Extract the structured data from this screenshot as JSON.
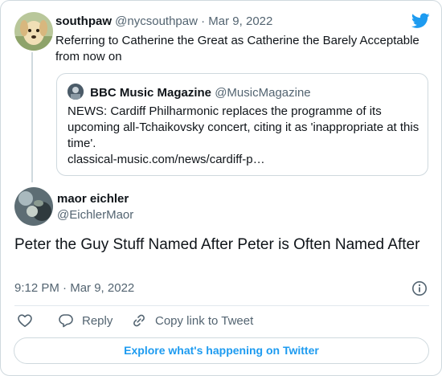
{
  "reply_tweet": {
    "author_name": "southpaw",
    "author_handle": "@nycsouthpaw",
    "separator": "·",
    "date": "Mar 9, 2022",
    "text": "Referring to Catherine the Great as Catherine the Barely Acceptable from now on",
    "avatar_icon": "dog-avatar",
    "logo_icon": "twitter-bird-icon"
  },
  "quoted_tweet": {
    "author_name": "BBC Music Magazine",
    "author_handle": "@MusicMagazine",
    "text": "NEWS: Cardiff Philharmonic replaces the programme of its upcoming all-Tchaikovsky concert, citing it as 'inappropriate at this time'.",
    "link": "classical-music.com/news/cardiff-p…"
  },
  "main_tweet": {
    "author_name": "maor eichler",
    "author_handle": "@EichlerMaor",
    "text": "Peter the Guy Stuff Named After Peter is Often Named After",
    "time": "9:12 PM",
    "separator": "·",
    "date": "Mar 9, 2022"
  },
  "actions": {
    "like_icon": "heart-icon",
    "reply_label": "Reply",
    "copy_link_label": "Copy link to Tweet"
  },
  "explore_label": "Explore what's happening on Twitter",
  "colors": {
    "accent": "#1d9bf0",
    "text": "#0f1419",
    "secondary": "#536471",
    "border": "#cfd9de"
  }
}
